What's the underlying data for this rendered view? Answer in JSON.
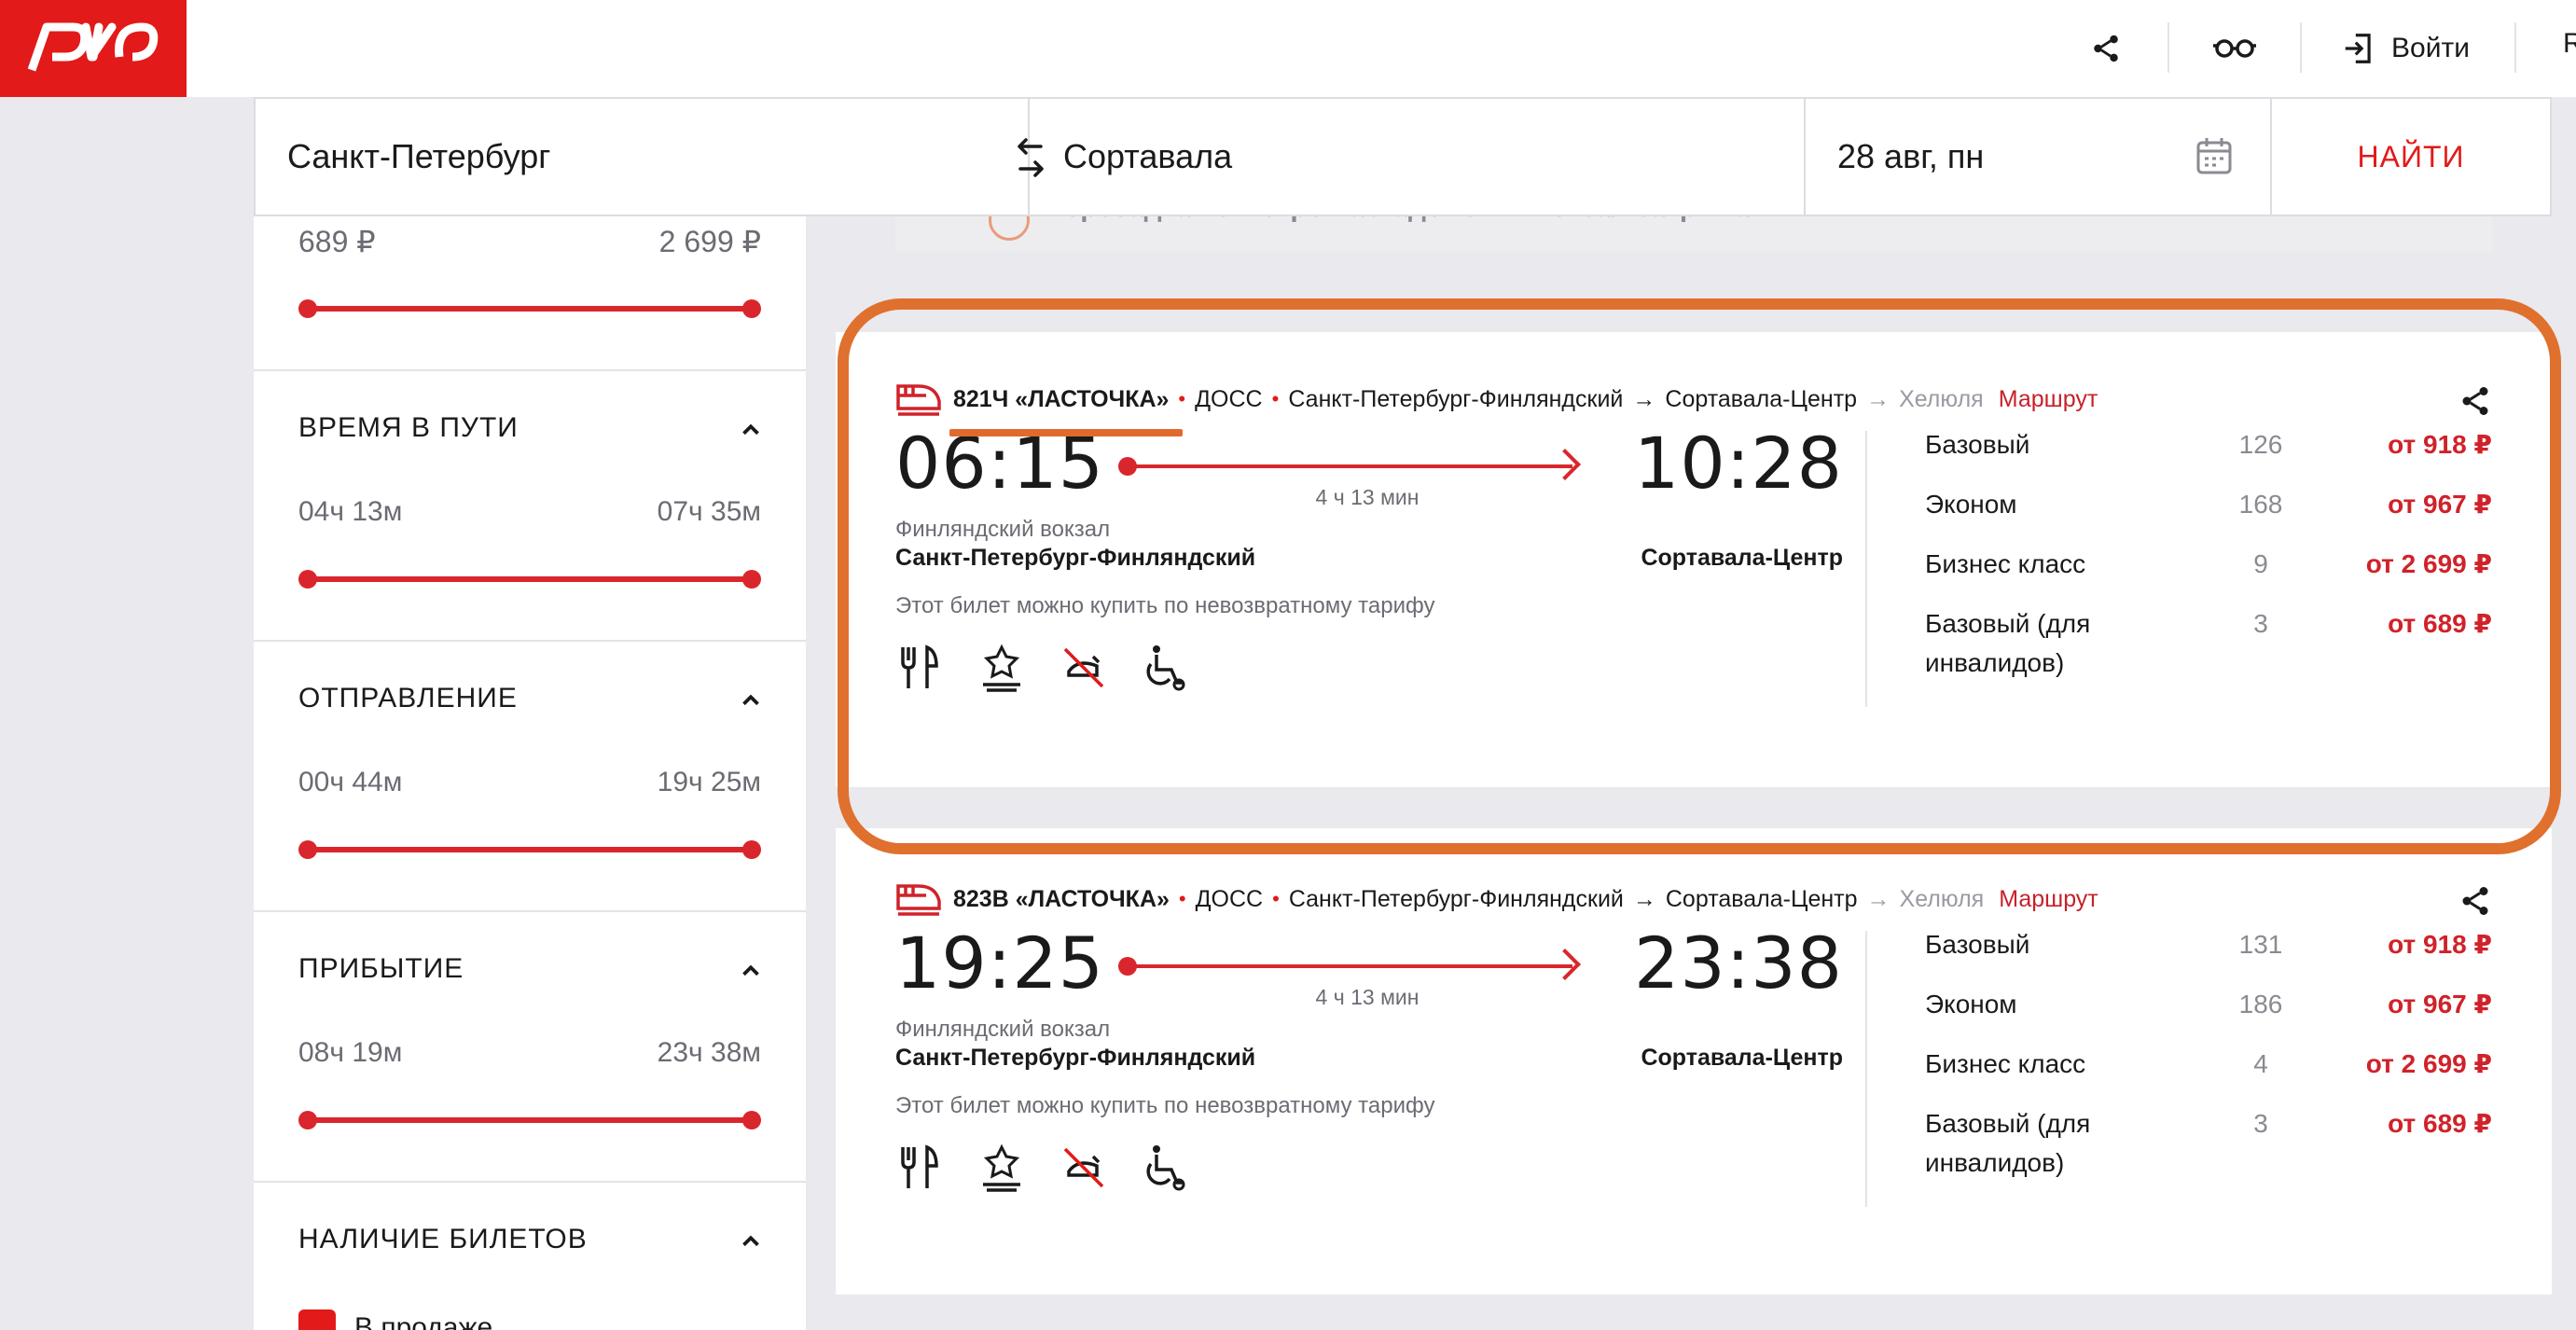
{
  "header": {
    "logo_text": "РЖД",
    "login_label": "Войти",
    "lang_label": "R"
  },
  "search": {
    "from": "Санкт-Петербург",
    "to": "Сортавала",
    "date": "28 авг, пн",
    "find_label": "НАЙТИ"
  },
  "filters": {
    "price_min": "689 ₽",
    "price_max": "2 699 ₽",
    "sections": [
      {
        "title": "ВРЕМЯ В ПУТИ",
        "min": "04ч 13м",
        "max": "07ч 35м"
      },
      {
        "title": "ОТПРАВЛЕНИЕ",
        "min": "00ч 44м",
        "max": "19ч 25м"
      },
      {
        "title": "ПРИБЫТИЕ",
        "min": "08ч 19м",
        "max": "23ч 38м"
      },
      {
        "title": "НАЛИЧИЕ БИЛЕТОВ"
      }
    ],
    "checkbox_label": "В продаже"
  },
  "notice": {
    "text": "Пересадка из Метро на Ладожский вокзал закрыта"
  },
  "trains": [
    {
      "number": "821Ч «ЛАСТОЧКА»",
      "carrier": "ДОСС",
      "from": "Санкт-Петербург-Финляндский",
      "to": "Сортавала-Центр",
      "final": "Хелюля",
      "route_label": "Маршрут",
      "dep_time": "06:15",
      "arr_time": "10:28",
      "duration": "4 ч 13 мин",
      "dep_station_small": "Финляндский вокзал",
      "dep_station": "Санкт-Петербург-Финляндский",
      "arr_station": "Сортавала-Центр",
      "note": "Этот билет можно купить по невозвратному тарифу",
      "classes": [
        {
          "name": "Базовый",
          "seats": "126",
          "price": "от 918 ₽"
        },
        {
          "name": "Эконом",
          "seats": "168",
          "price": "от 967 ₽"
        },
        {
          "name": "Бизнес класс",
          "seats": "9",
          "price": "от 2 699 ₽"
        },
        {
          "name": "Базовый (для инвалидов)",
          "seats": "3",
          "price": "от 689 ₽"
        }
      ]
    },
    {
      "number": "823В «ЛАСТОЧКА»",
      "carrier": "ДОСС",
      "from": "Санкт-Петербург-Финляндский",
      "to": "Сортавала-Центр",
      "final": "Хелюля",
      "route_label": "Маршрут",
      "dep_time": "19:25",
      "arr_time": "23:38",
      "duration": "4 ч 13 мин",
      "dep_station_small": "Финляндский вокзал",
      "dep_station": "Санкт-Петербург-Финляндский",
      "arr_station": "Сортавала-Центр",
      "note": "Этот билет можно купить по невозвратному тарифу",
      "classes": [
        {
          "name": "Базовый",
          "seats": "131",
          "price": "от 918 ₽"
        },
        {
          "name": "Эконом",
          "seats": "186",
          "price": "от 967 ₽"
        },
        {
          "name": "Бизнес класс",
          "seats": "4",
          "price": "от 2 699 ₽"
        },
        {
          "name": "Базовый (для инвалидов)",
          "seats": "3",
          "price": "от 689 ₽"
        }
      ]
    }
  ],
  "colors": {
    "brand_red": "#e21a1a",
    "price_red": "#d0222a",
    "highlight_orange": "#e0702e"
  },
  "icons": [
    "share-icon",
    "glasses-icon",
    "login-icon",
    "swap-icon",
    "calendar-icon",
    "chevron-up-icon",
    "train-icon",
    "restaurant-icon",
    "premium-icon",
    "no-pets-icon",
    "wheelchair-icon"
  ]
}
